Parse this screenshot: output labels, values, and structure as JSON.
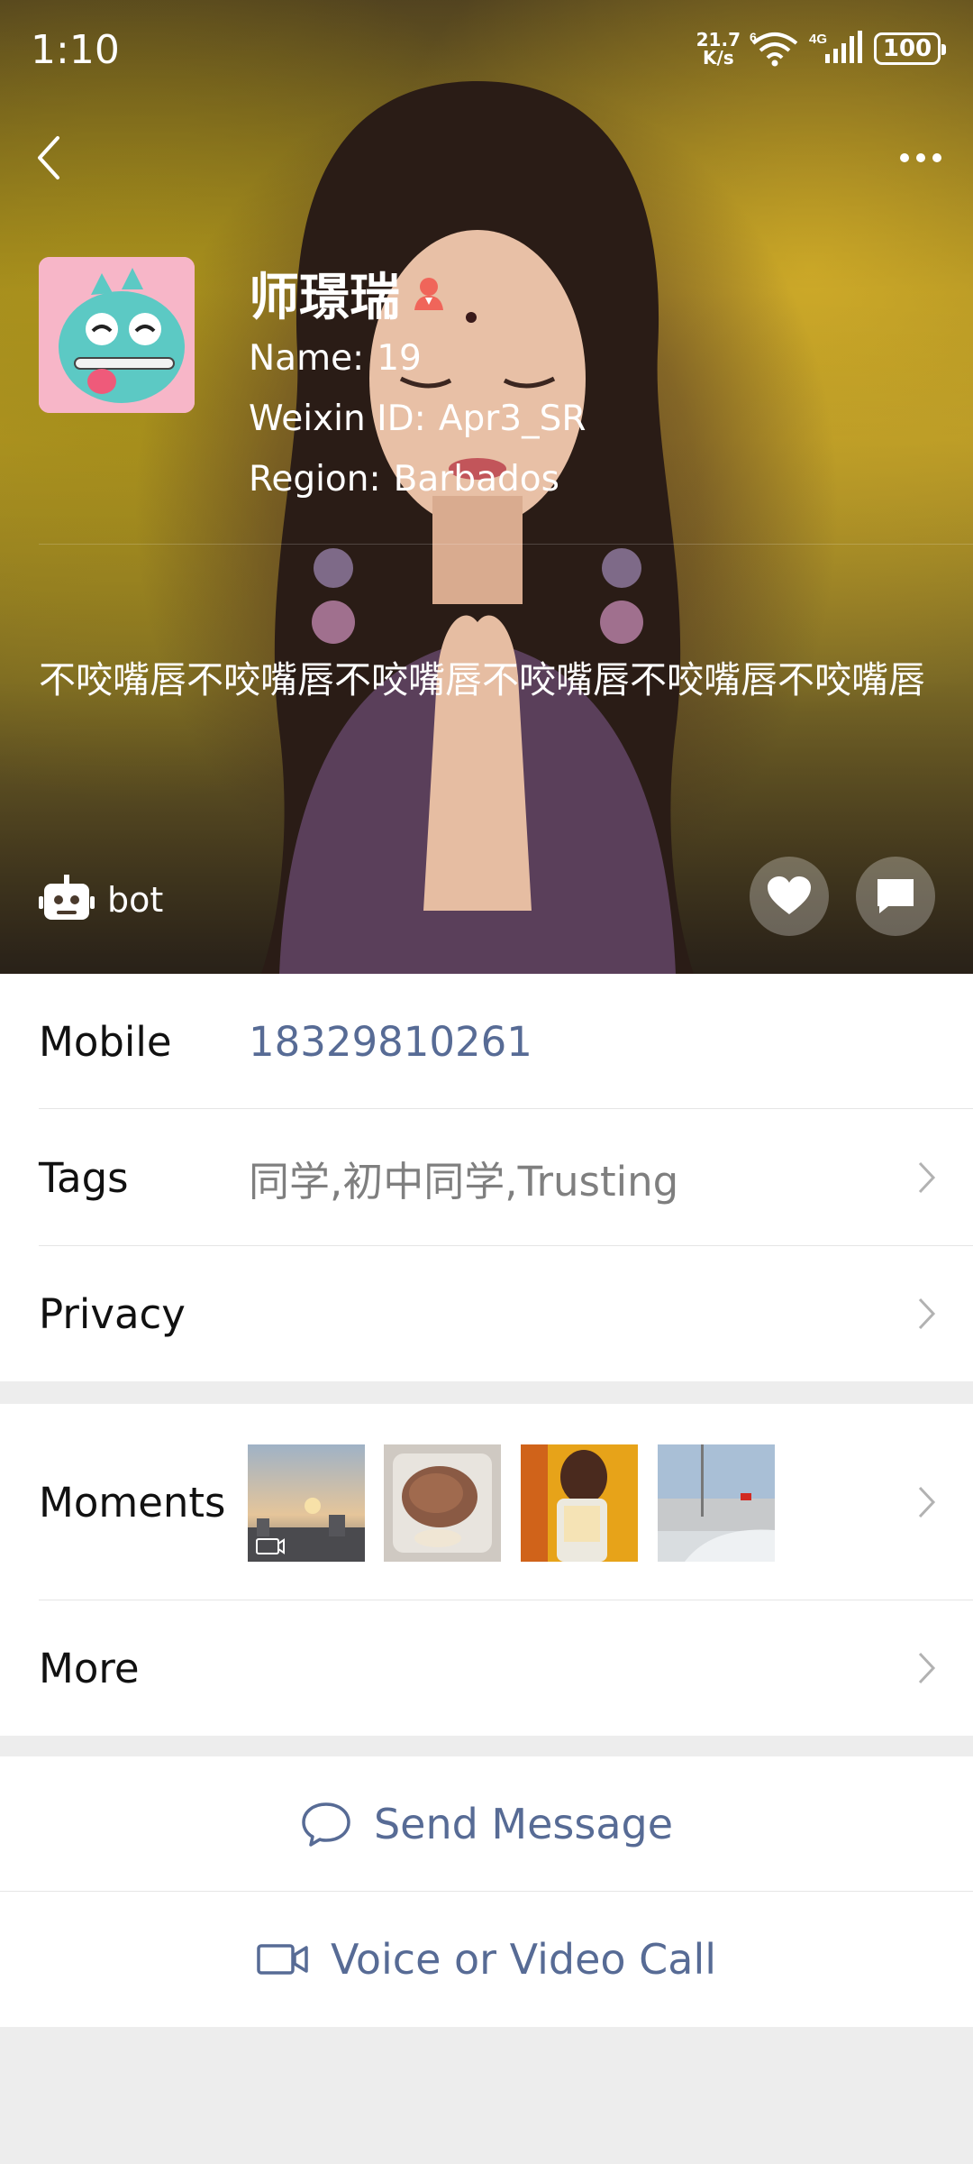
{
  "status_bar": {
    "time": "1:10",
    "net_speed": "21.7",
    "net_unit": "K/s",
    "wifi_badge": "6",
    "network": "4G",
    "battery": "100"
  },
  "profile": {
    "nickname": "师璟瑞",
    "name_label": "Name:",
    "name_value": "19",
    "weixin_label": "Weixin ID:",
    "weixin_value": "Apr3_SR",
    "region_label": "Region:",
    "region_value": "Barbados",
    "signature": "不咬嘴唇不咬嘴唇不咬嘴唇不咬嘴唇不咬嘴唇不咬嘴唇",
    "bot_label": "bot"
  },
  "rows": {
    "mobile_label": "Mobile",
    "mobile_value": "18329810261",
    "tags_label": "Tags",
    "tags_value": "同学,初中同学,Trusting",
    "privacy_label": "Privacy",
    "moments_label": "Moments",
    "more_label": "More"
  },
  "actions": {
    "send_message": "Send Message",
    "call": "Voice or Video Call"
  },
  "colors": {
    "link": "#576b95",
    "tags": "#7f7f7f",
    "page_bg": "#ededed"
  }
}
